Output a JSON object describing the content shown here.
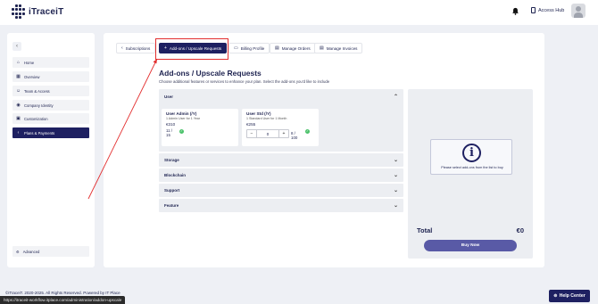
{
  "header": {
    "logo_text": "iTraceiT",
    "access_hub_label": "Access Hub",
    "icons": {
      "notifications": "bell-icon",
      "access_hub": "document-icon",
      "avatar": "user-avatar"
    }
  },
  "sidebar": {
    "collapse_icon": "chevron-left-icon",
    "items": [
      {
        "label": "Home",
        "icon": "home-icon"
      },
      {
        "label": "Overview",
        "icon": "dashboard-icon"
      },
      {
        "label": "Team & Access",
        "icon": "team-icon"
      },
      {
        "label": "Company Identity",
        "icon": "building-icon"
      },
      {
        "label": "Customization",
        "icon": "palette-icon"
      },
      {
        "label": "Plans & Payments",
        "icon": "chevron-left-icon",
        "active": true
      }
    ],
    "advanced_label": "Advanced",
    "advanced_icon": "gear-icon"
  },
  "tabs": [
    {
      "label": "Subscriptions",
      "icon": "chevron-left-icon"
    },
    {
      "label": "Add-ons / Upscale Requests",
      "icon": "plus-icon",
      "active": true
    },
    {
      "label": "Billing Profile",
      "icon": "card-icon"
    },
    {
      "label": "Manage Orders",
      "icon": "orders-icon"
    },
    {
      "label": "Manage Invoices",
      "icon": "invoice-icon"
    }
  ],
  "page": {
    "title": "Add-ons / Upscale Requests",
    "subtitle": "Choose additional features or services to enhance your plan. Select the add-ons you'd like to include"
  },
  "sections": {
    "user": "User",
    "storage": "Storage",
    "blockchain": "Blockchain",
    "support": "Support",
    "feature": "Feature"
  },
  "addons": [
    {
      "title": "User Admin (/Y)",
      "description": "1 Admin User for 1 Year",
      "price": "€310",
      "count": "11 /",
      "count_total": "15"
    },
    {
      "title": "User Std (/Y)",
      "description": "1 Standard User for 1 Month",
      "price": "€255",
      "quantity": "0",
      "count": "8 /",
      "count_total": "100"
    }
  ],
  "summary": {
    "info_text": "Please select add-ons from the list to buy",
    "total_label": "Total",
    "total_value": "€0",
    "buy_label": "Buy Now"
  },
  "footer": {
    "copyright": "©iTraceiT. 2020-2025. All Rights Reserved. Powered by IT Place",
    "status_url": "https://itraceit-workflow.itplace.com/administration/addon-upscale",
    "help_label": "Help Center"
  },
  "colors": {
    "primary": "#1e2061",
    "accent_button": "#595aa6",
    "annotation_red": "#e32f2f",
    "ok_green": "#4cc26b"
  }
}
